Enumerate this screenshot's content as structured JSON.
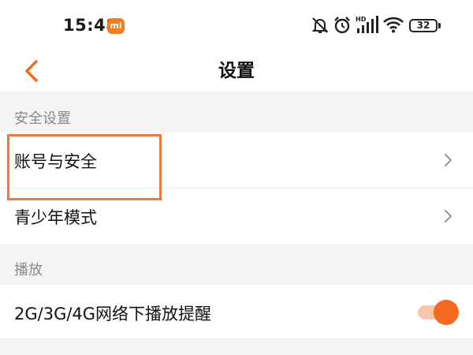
{
  "status_bar": {
    "time": "15:48",
    "carrier_badge": "mi",
    "battery": "32",
    "icons": [
      "mute-bell-icon",
      "alarm-icon",
      "hd-signal-icon",
      "wifi-icon",
      "battery-icon"
    ]
  },
  "nav": {
    "title": "设置",
    "back_icon": "chevron-left-icon"
  },
  "sections": [
    {
      "header": "安全设置",
      "items": [
        {
          "label": "账号与安全",
          "icon": "chevron-right-icon",
          "highlighted": true
        },
        {
          "label": "青少年模式",
          "icon": "chevron-right-icon"
        }
      ]
    },
    {
      "header": "播放",
      "items": [
        {
          "label": "2G/3G/4G网络下播放提醒",
          "toggle": true
        }
      ]
    }
  ],
  "colors": {
    "accent": "#f46a20",
    "highlight_border": "#f07a3a",
    "toggle_track": "#f8c7aa",
    "background": "#f4f4f4",
    "section_header_text": "#8a8a8a"
  }
}
